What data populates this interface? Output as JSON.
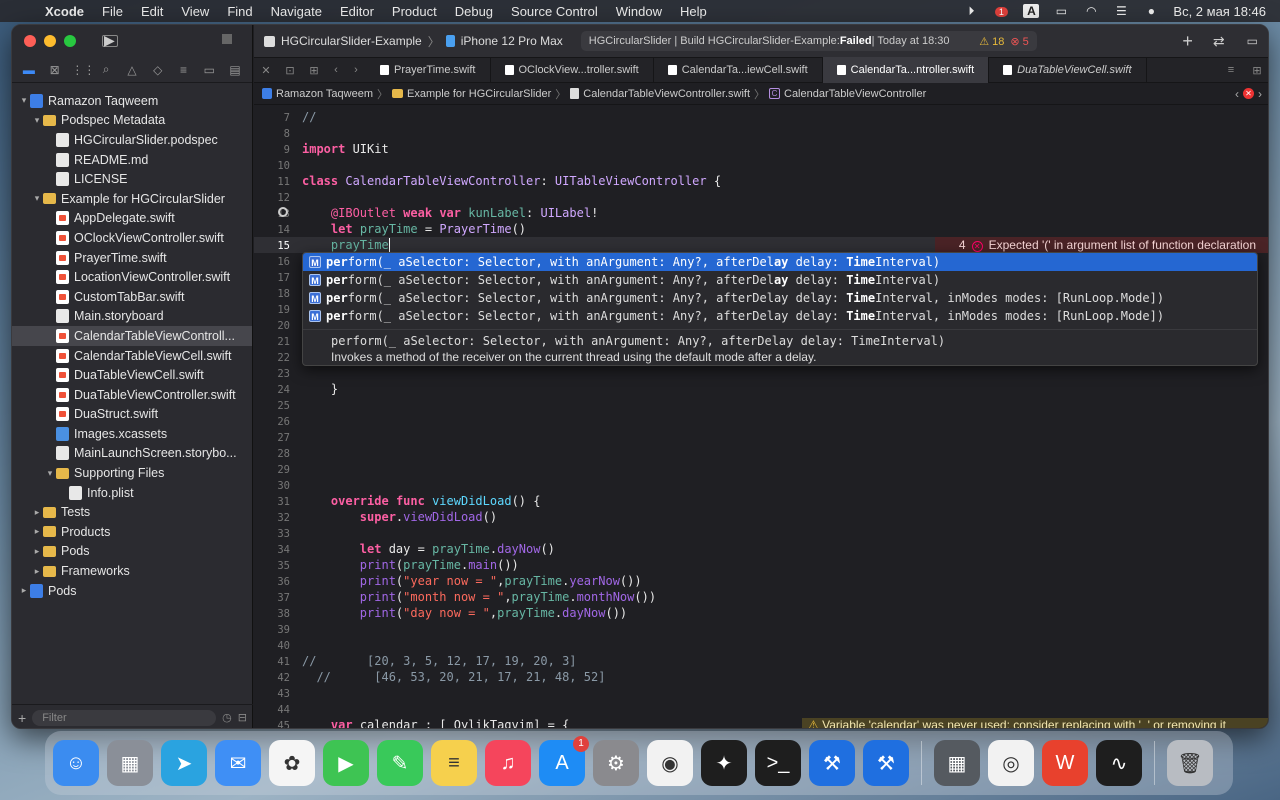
{
  "menubar": {
    "apple": "",
    "app": "Xcode",
    "items": [
      "File",
      "Edit",
      "View",
      "Find",
      "Navigate",
      "Editor",
      "Product",
      "Debug",
      "Source Control",
      "Window",
      "Help"
    ],
    "notification_badge": "1",
    "input_source": "A",
    "datetime": "Вс, 2 мая  18:46"
  },
  "toolbar": {
    "scheme": "HGCircularSlider-Example",
    "device": "iPhone 12 Pro Max",
    "status_prefix": "HGCircularSlider | Build HGCircularSlider-Example: ",
    "status_result": "Failed",
    "status_time": " | Today at 18:30",
    "warnings": "18",
    "errors": "5"
  },
  "tabs": [
    "PrayerTime.swift",
    "OClockView...troller.swift",
    "CalendarTa...iewCell.swift",
    "CalendarTa...ntroller.swift",
    "DuaTableViewCell.swift"
  ],
  "breadcrumb": [
    "Ramazon Taqweem",
    "Example for HGCircularSlider",
    "CalendarTableViewController.swift",
    "CalendarTableViewController"
  ],
  "navigator": {
    "filter_placeholder": "Filter",
    "items": [
      {
        "label": "Ramazon Taqweem",
        "level": 0,
        "icon": "proj",
        "disc": "▾"
      },
      {
        "label": "Podspec Metadata",
        "level": 1,
        "icon": "folder",
        "disc": "▾"
      },
      {
        "label": "HGCircularSlider.podspec",
        "level": 2,
        "icon": "doc",
        "disc": ""
      },
      {
        "label": "README.md",
        "level": 2,
        "icon": "doc",
        "disc": ""
      },
      {
        "label": "LICENSE",
        "level": 2,
        "icon": "doc",
        "disc": ""
      },
      {
        "label": "Example for HGCircularSlider",
        "level": 1,
        "icon": "folder",
        "disc": "▾"
      },
      {
        "label": "AppDelegate.swift",
        "level": 2,
        "icon": "swift",
        "disc": ""
      },
      {
        "label": "OClockViewController.swift",
        "level": 2,
        "icon": "swift",
        "disc": ""
      },
      {
        "label": "PrayerTime.swift",
        "level": 2,
        "icon": "swift",
        "disc": ""
      },
      {
        "label": "LocationViewController.swift",
        "level": 2,
        "icon": "swift",
        "disc": ""
      },
      {
        "label": "CustomTabBar.swift",
        "level": 2,
        "icon": "swift",
        "disc": ""
      },
      {
        "label": "Main.storyboard",
        "level": 2,
        "icon": "doc",
        "disc": ""
      },
      {
        "label": "CalendarTableViewControll...",
        "level": 2,
        "icon": "swift",
        "disc": "",
        "selected": true
      },
      {
        "label": "CalendarTableViewCell.swift",
        "level": 2,
        "icon": "swift",
        "disc": ""
      },
      {
        "label": "DuaTableViewCell.swift",
        "level": 2,
        "icon": "swift",
        "disc": ""
      },
      {
        "label": "DuaTableViewController.swift",
        "level": 2,
        "icon": "swift",
        "disc": ""
      },
      {
        "label": "DuaStruct.swift",
        "level": 2,
        "icon": "swift",
        "disc": ""
      },
      {
        "label": "Images.xcassets",
        "level": 2,
        "icon": "asset",
        "disc": ""
      },
      {
        "label": "MainLaunchScreen.storybo...",
        "level": 2,
        "icon": "doc",
        "disc": ""
      },
      {
        "label": "Supporting Files",
        "level": 2,
        "icon": "folder",
        "disc": "▾"
      },
      {
        "label": "Info.plist",
        "level": 3,
        "icon": "doc",
        "disc": ""
      },
      {
        "label": "Tests",
        "level": 1,
        "icon": "folder",
        "disc": "▸"
      },
      {
        "label": "Products",
        "level": 1,
        "icon": "folder",
        "disc": "▸"
      },
      {
        "label": "Pods",
        "level": 1,
        "icon": "folder",
        "disc": "▸"
      },
      {
        "label": "Frameworks",
        "level": 1,
        "icon": "folder",
        "disc": "▸"
      },
      {
        "label": "Pods",
        "level": 0,
        "icon": "proj",
        "disc": "▸"
      }
    ]
  },
  "editor": {
    "line_numbers": [
      "7",
      "8",
      "9",
      "10",
      "11",
      "12",
      "13",
      "14",
      "15",
      "16",
      "17",
      "18",
      "19",
      "20",
      "21",
      "22",
      "23",
      "24",
      "25",
      "26",
      "27",
      "28",
      "29",
      "30",
      "31",
      "32",
      "33",
      "34",
      "35",
      "36",
      "37",
      "38",
      "39",
      "40",
      "41",
      "42",
      "43",
      "44",
      "45"
    ],
    "current_line": "15",
    "error_count": "4",
    "error_message": "Expected '(' in argument list of function declaration",
    "warning_message": "Variable 'calendar' was never used; consider replacing with '_' or removing it"
  },
  "autocomplete": {
    "badge": "M",
    "suggestions": [
      {
        "a": "per",
        "b": "form(_ aSelector: Selector, with anArgument: Any?, afterDel",
        "c": "ay",
        "d": " delay: ",
        "e": "Time",
        "f": "Interval)"
      },
      {
        "a": "per",
        "b": "form(_ aSelector: Selector, with anArgument: Any?, afterDel",
        "c": "ay",
        "d": " delay: ",
        "e": "Time",
        "f": "Interval)"
      },
      {
        "a": "per",
        "b": "form(_ aSelector: Selector, with anArgument: Any?, afterDelay delay: ",
        "c": "",
        "d": "",
        "e": "Time",
        "f": "Interval, inModes modes: [RunLoop.Mode])"
      },
      {
        "a": "per",
        "b": "form(_ aSelector: Selector, with anArgument: Any?, afterDelay delay: ",
        "c": "",
        "d": "",
        "e": "Time",
        "f": "Interval, inModes modes: [RunLoop.Mode])"
      }
    ],
    "detail_signature": "perform(_ aSelector: Selector, with anArgument: Any?, afterDelay delay: TimeInterval)",
    "detail_description": "Invokes a method of the receiver on the current thread using the default mode after a delay."
  },
  "dock": {
    "apps": [
      "finder-icon",
      "launchpad-icon",
      "telegram-icon",
      "mail-icon",
      "photos-icon",
      "facetime-icon",
      "messages-icon",
      "notes-icon",
      "music-icon",
      "appstore-icon",
      "settings-icon",
      "chrome-icon",
      "figma-icon",
      "terminal-icon",
      "xcode-icon",
      "xcode-beta-icon",
      "calculator-icon",
      "safari-icon",
      "office-icon",
      "activity-monitor-icon",
      "trash-icon"
    ],
    "appstore_badge": "1"
  }
}
